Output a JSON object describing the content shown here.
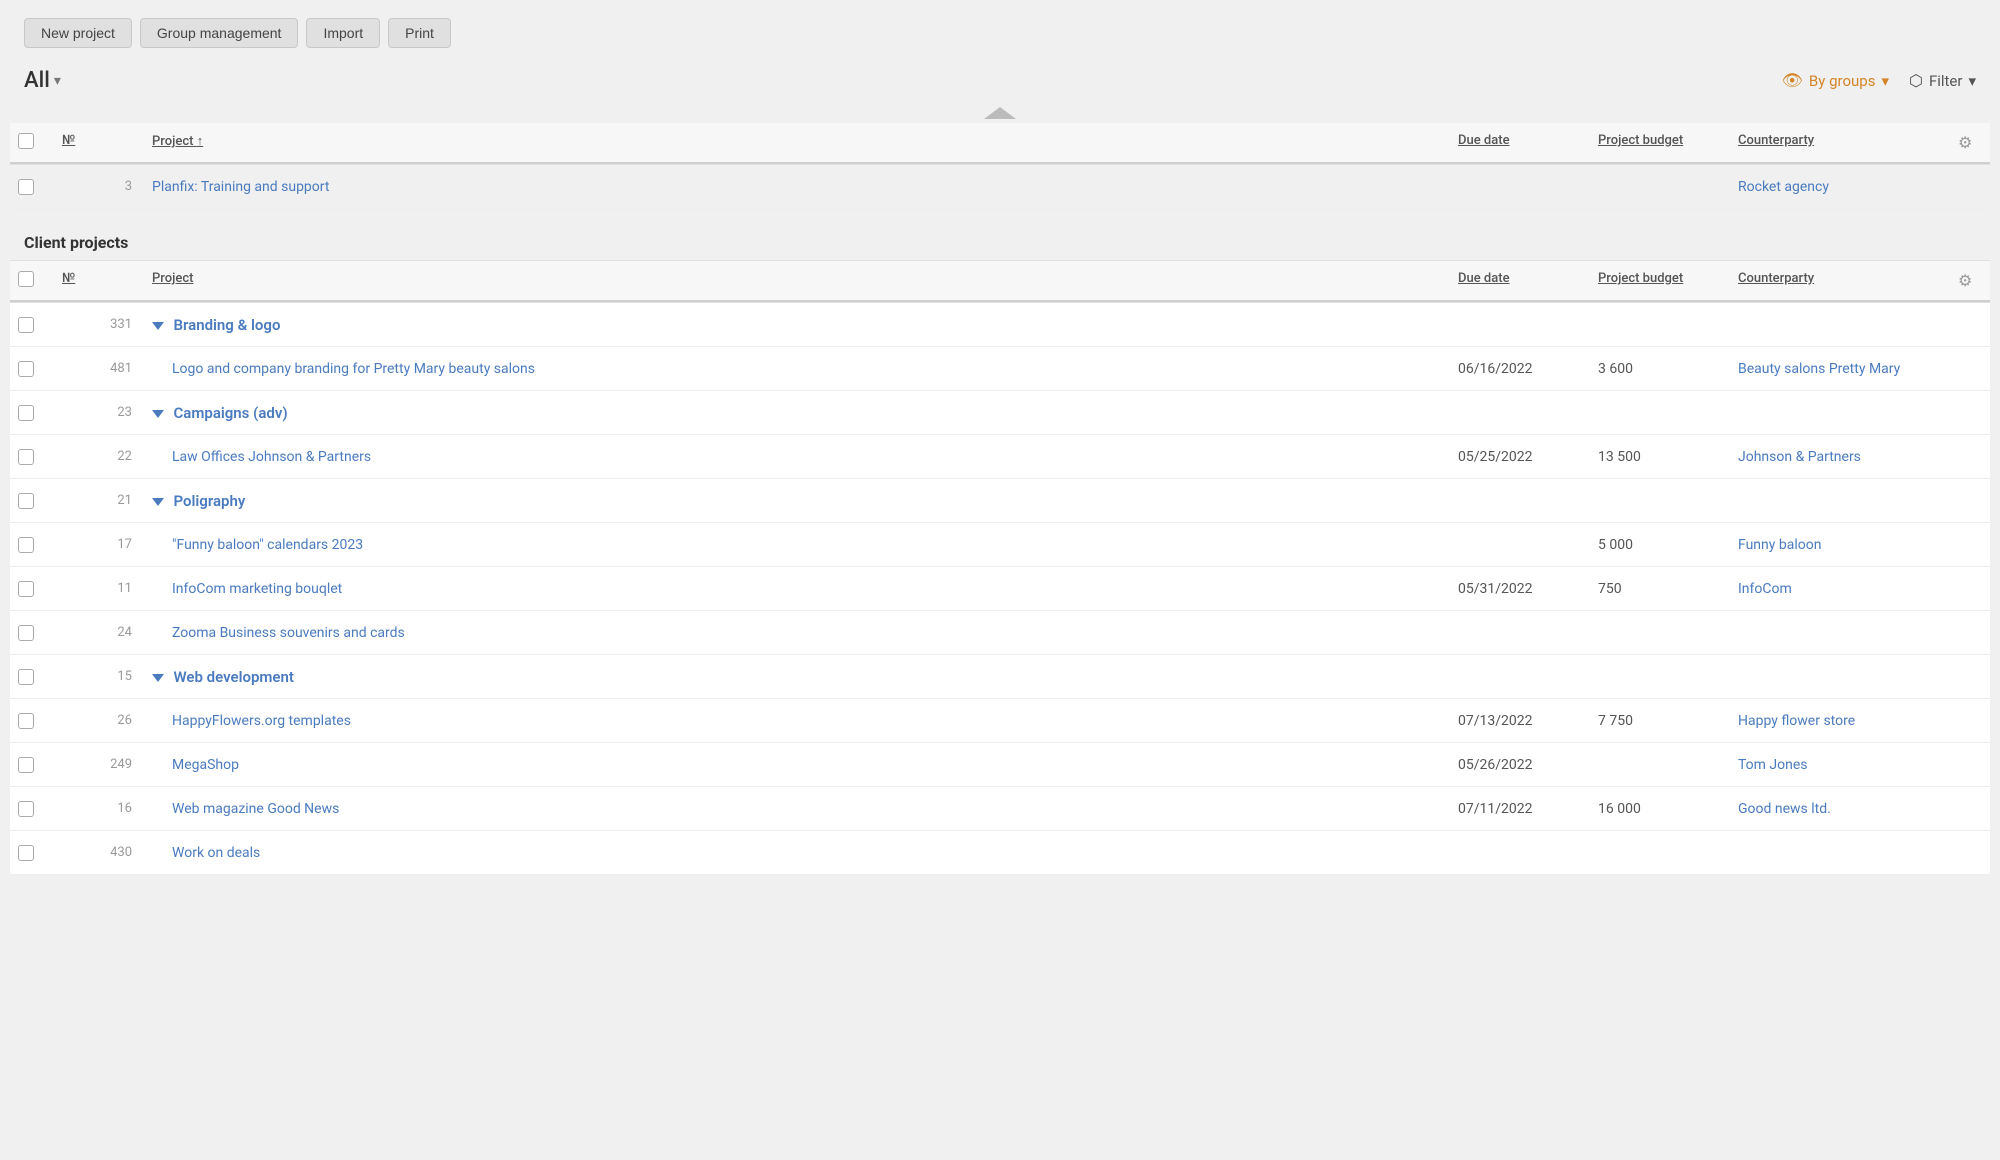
{
  "toolbar": {
    "buttons": [
      {
        "label": "New project",
        "name": "new-project-button"
      },
      {
        "label": "Group management",
        "name": "group-management-button"
      },
      {
        "label": "Import",
        "name": "import-button"
      },
      {
        "label": "Print",
        "name": "print-button"
      }
    ]
  },
  "header": {
    "view_label": "All",
    "view_chevron": "▾",
    "by_groups_label": "By groups",
    "by_groups_chevron": "▾",
    "filter_label": "Filter",
    "filter_chevron": "▾"
  },
  "columns": {
    "checkbox": "",
    "number": "№",
    "project": "Project",
    "due_date": "Due date",
    "project_budget": "Project budget",
    "counterparty": "Counterparty",
    "settings": "⚙"
  },
  "standalone_rows": [
    {
      "number": "3",
      "project": "Planfix: Training and support",
      "due_date": "",
      "project_budget": "",
      "counterparty": "Rocket agency"
    }
  ],
  "client_projects_label": "Client projects",
  "groups": [
    {
      "name": "Branding & logo",
      "number": "331",
      "rows": [
        {
          "number": "481",
          "project": "Logo and company branding for Pretty Mary beauty salons",
          "due_date": "06/16/2022",
          "project_budget": "3 600",
          "counterparty": "Beauty salons Pretty Mary"
        }
      ]
    },
    {
      "name": "Campaigns (adv)",
      "number": "23",
      "rows": [
        {
          "number": "22",
          "project": "Law Offices Johnson & Partners",
          "due_date": "05/25/2022",
          "project_budget": "13 500",
          "counterparty": "Johnson & Partners"
        }
      ]
    },
    {
      "name": "Poligraphy",
      "number": "21",
      "rows": [
        {
          "number": "17",
          "project": "\"Funny baloon\" calendars 2023",
          "due_date": "",
          "project_budget": "5 000",
          "counterparty": "Funny baloon"
        },
        {
          "number": "11",
          "project": "InfoCom marketing bouqlet",
          "due_date": "05/31/2022",
          "project_budget": "750",
          "counterparty": "InfoCom"
        },
        {
          "number": "24",
          "project": "Zooma Business souvenirs and cards",
          "due_date": "",
          "project_budget": "",
          "counterparty": ""
        }
      ]
    },
    {
      "name": "Web development",
      "number": "15",
      "rows": [
        {
          "number": "26",
          "project": "HappyFlowers.org templates",
          "due_date": "07/13/2022",
          "project_budget": "7 750",
          "counterparty": "Happy flower store"
        },
        {
          "number": "249",
          "project": "MegaShop",
          "due_date": "05/26/2022",
          "project_budget": "",
          "counterparty": "Tom Jones"
        },
        {
          "number": "16",
          "project": "Web magazine Good News",
          "due_date": "07/11/2022",
          "project_budget": "16 000",
          "counterparty": "Good news ltd."
        },
        {
          "number": "430",
          "project": "Work on deals",
          "due_date": "",
          "project_budget": "",
          "counterparty": ""
        }
      ]
    }
  ]
}
